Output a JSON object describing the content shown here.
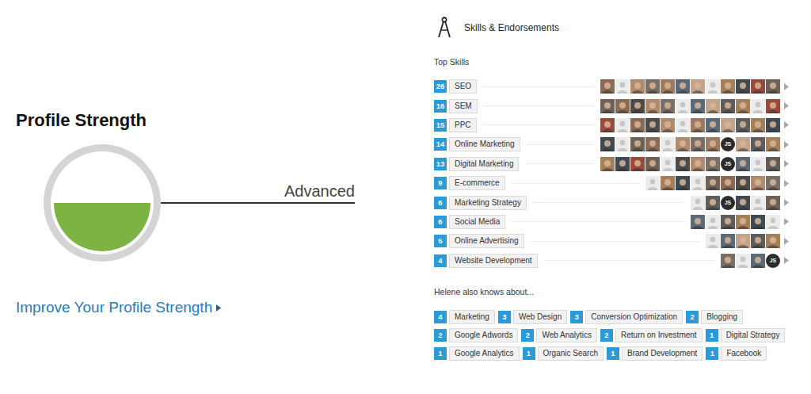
{
  "profile_strength": {
    "title": "Profile Strength",
    "level": 0.5,
    "rating": "Advanced",
    "link": "Improve Your Profile Strength"
  },
  "skills_section": {
    "title": "Skills & Endorsements",
    "top_title": "Top Skills",
    "other_title": "Helene also knows about..."
  },
  "top_skills": [
    {
      "count": "26",
      "name": "SEO",
      "avatars": [
        {
          "kind": "photo"
        },
        {
          "kind": "blank"
        },
        {
          "kind": "photo"
        },
        {
          "kind": "photo"
        },
        {
          "kind": "photo"
        },
        {
          "kind": "photo"
        },
        {
          "kind": "photo"
        },
        {
          "kind": "blank"
        },
        {
          "kind": "photo"
        },
        {
          "kind": "photo"
        },
        {
          "kind": "photo"
        },
        {
          "kind": "photo"
        }
      ]
    },
    {
      "count": "16",
      "name": "SEM",
      "avatars": [
        {
          "kind": "photo"
        },
        {
          "kind": "photo"
        },
        {
          "kind": "photo"
        },
        {
          "kind": "photo"
        },
        {
          "kind": "photo"
        },
        {
          "kind": "blank"
        },
        {
          "kind": "photo"
        },
        {
          "kind": "photo"
        },
        {
          "kind": "photo"
        },
        {
          "kind": "photo"
        },
        {
          "kind": "blank"
        },
        {
          "kind": "photo"
        }
      ]
    },
    {
      "count": "15",
      "name": "PPC",
      "avatars": [
        {
          "kind": "photo"
        },
        {
          "kind": "blank"
        },
        {
          "kind": "photo"
        },
        {
          "kind": "photo"
        },
        {
          "kind": "photo"
        },
        {
          "kind": "blank"
        },
        {
          "kind": "photo"
        },
        {
          "kind": "photo"
        },
        {
          "kind": "photo"
        },
        {
          "kind": "photo"
        },
        {
          "kind": "photo"
        },
        {
          "kind": "photo"
        }
      ]
    },
    {
      "count": "14",
      "name": "Online Marketing",
      "avatars": [
        {
          "kind": "photo"
        },
        {
          "kind": "blank"
        },
        {
          "kind": "photo"
        },
        {
          "kind": "photo"
        },
        {
          "kind": "blank"
        },
        {
          "kind": "photo"
        },
        {
          "kind": "photo"
        },
        {
          "kind": "photo"
        },
        {
          "kind": "initials",
          "text": "JS"
        },
        {
          "kind": "photo"
        },
        {
          "kind": "photo"
        },
        {
          "kind": "photo"
        }
      ]
    },
    {
      "count": "13",
      "name": "Digital Marketing",
      "avatars": [
        {
          "kind": "photo"
        },
        {
          "kind": "photo"
        },
        {
          "kind": "photo"
        },
        {
          "kind": "photo"
        },
        {
          "kind": "blank"
        },
        {
          "kind": "photo"
        },
        {
          "kind": "photo"
        },
        {
          "kind": "photo"
        },
        {
          "kind": "initials",
          "text": "JS"
        },
        {
          "kind": "photo"
        },
        {
          "kind": "blank"
        },
        {
          "kind": "photo"
        }
      ]
    },
    {
      "count": "9",
      "name": "E-commerce",
      "avatars": [
        {
          "kind": "blank"
        },
        {
          "kind": "photo"
        },
        {
          "kind": "photo"
        },
        {
          "kind": "blank"
        },
        {
          "kind": "photo"
        },
        {
          "kind": "photo"
        },
        {
          "kind": "photo"
        },
        {
          "kind": "photo"
        },
        {
          "kind": "photo"
        }
      ]
    },
    {
      "count": "6",
      "name": "Marketing Strategy",
      "avatars": [
        {
          "kind": "blank"
        },
        {
          "kind": "photo"
        },
        {
          "kind": "initials",
          "text": "JS"
        },
        {
          "kind": "photo"
        },
        {
          "kind": "blank"
        },
        {
          "kind": "photo"
        }
      ]
    },
    {
      "count": "6",
      "name": "Social Media",
      "avatars": [
        {
          "kind": "photo"
        },
        {
          "kind": "blank"
        },
        {
          "kind": "photo"
        },
        {
          "kind": "photo"
        },
        {
          "kind": "photo"
        },
        {
          "kind": "blank"
        }
      ]
    },
    {
      "count": "5",
      "name": "Online Advertising",
      "avatars": [
        {
          "kind": "blank"
        },
        {
          "kind": "photo"
        },
        {
          "kind": "photo"
        },
        {
          "kind": "photo"
        },
        {
          "kind": "photo"
        }
      ]
    },
    {
      "count": "4",
      "name": "Website Development",
      "avatars": [
        {
          "kind": "photo"
        },
        {
          "kind": "blank"
        },
        {
          "kind": "photo"
        },
        {
          "kind": "initials",
          "text": "JS"
        }
      ]
    }
  ],
  "other_skills": [
    {
      "count": "4",
      "name": "Marketing"
    },
    {
      "count": "3",
      "name": "Web Design"
    },
    {
      "count": "3",
      "name": "Conversion Optimization"
    },
    {
      "count": "2",
      "name": "Blogging"
    },
    {
      "count": "2",
      "name": "Google Adwords"
    },
    {
      "count": "2",
      "name": "Web Analytics"
    },
    {
      "count": "2",
      "name": "Return on Investment"
    },
    {
      "count": "1",
      "name": "Digital Strategy"
    },
    {
      "count": "1",
      "name": "Google Analytics"
    },
    {
      "count": "1",
      "name": "Organic Search"
    },
    {
      "count": "1",
      "name": "Brand Development"
    },
    {
      "count": "1",
      "name": "Facebook"
    }
  ]
}
